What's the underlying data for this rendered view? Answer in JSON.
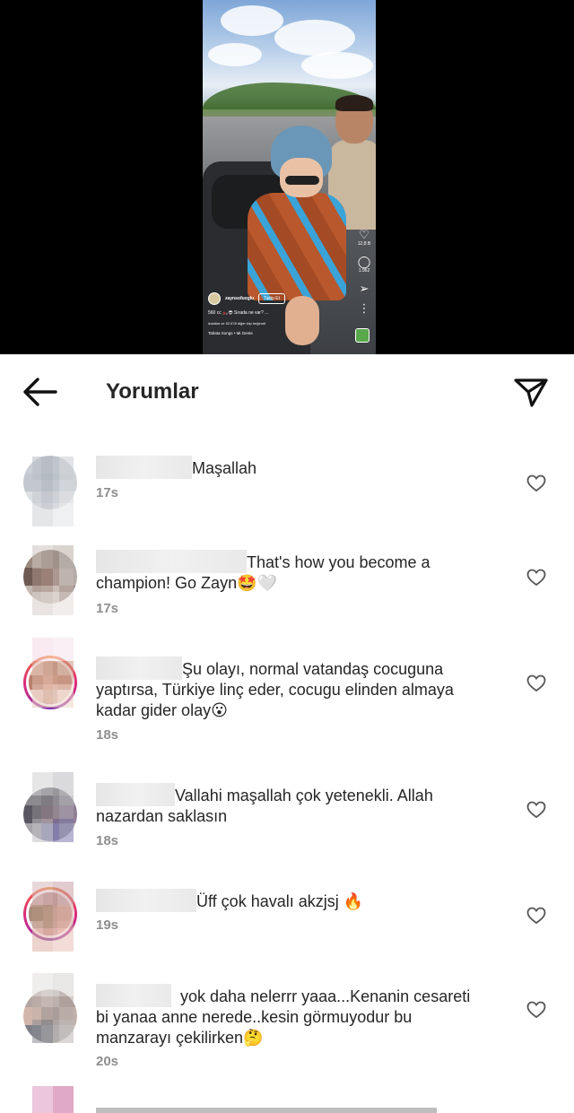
{
  "reel": {
    "username": "zaynsofuoglu",
    "follow_label": "Takip Et",
    "caption": "560 cc 🏍️😎 Sırada ne var? ...",
    "liked_by": "dolatlar ve 92.678 diğer kişi beğendi",
    "audio": "Tabata Songs • Mi Gente",
    "like_count": "12,8 B",
    "comment_count": "1.962",
    "icons": [
      "heart-icon",
      "comment-icon",
      "share-icon",
      "more-icon"
    ]
  },
  "header": {
    "title": "Yorumlar",
    "back_icon": "arrow-left-icon",
    "send_icon": "paper-plane-icon"
  },
  "comments": [
    {
      "text": "Maşallah",
      "time": "17s",
      "story_ring": false
    },
    {
      "text_line1": "That's how you become a",
      "text_line2": "champion! Go Zayn🤩🤍",
      "time": "17s",
      "story_ring": false
    },
    {
      "text_line1": "Şu olayı, normal vatandaş cocuguna",
      "text_line2": "yaptırsa, Türkiye linç eder, cocugu elinden almaya",
      "text_line3": "kadar gider olay😮",
      "time": "18s",
      "story_ring": true
    },
    {
      "text_line1": "Vallahi maşallah çok yetenekli. Allah",
      "text_line2": "nazardan saklasın",
      "time": "18s",
      "story_ring": false
    },
    {
      "text": "Üff çok havalı akzjsj 🔥",
      "time": "19s",
      "story_ring": true
    },
    {
      "text_line1": "yok daha nelerrr yaaa...Kenanin cesareti",
      "text_line2": "bi yanaa  anne nerede..kesin görmuyodur bu",
      "text_line3": "manzarayı çekilirken🤔",
      "time": "20s",
      "story_ring": false
    }
  ],
  "colors": {
    "text": "#262626",
    "muted": "#8e8e8e",
    "background": "#ffffff",
    "video_background": "#000000"
  }
}
